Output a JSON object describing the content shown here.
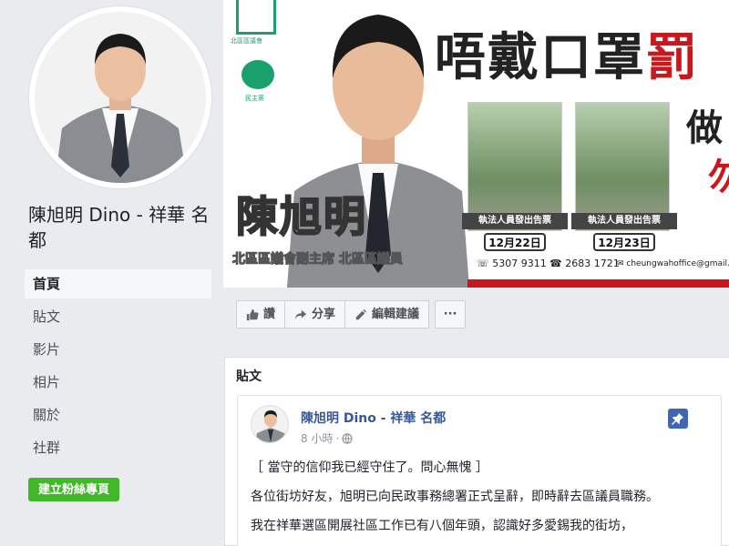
{
  "page": {
    "name": "陳旭明 Dino - 祥華 名都",
    "create_fan_page": "建立粉絲專頁"
  },
  "nav": {
    "items": [
      "首頁",
      "貼文",
      "影片",
      "相片",
      "關於",
      "社群"
    ]
  },
  "cover": {
    "headline_black": "唔戴口罩",
    "headline_red": "罰",
    "logo1_text": "北區區議會",
    "logo2_text": "民主黨",
    "big_name": "陳旭明",
    "subtitle": "北區區議會副主席  北區區議員",
    "photo_label": "執法人員發出告票",
    "date1": "12月22日",
    "date2": "12月23日",
    "side_text1": "做",
    "side_text2": "勿",
    "phone1": "5307 9311",
    "phone2": "2683 1721",
    "email": "cheungwahoffice@gmail.com"
  },
  "actions": {
    "like": "讚",
    "share": "分享",
    "edit": "編輯建議",
    "more": "···"
  },
  "posts": {
    "heading": "貼文",
    "author": "陳旭明 Dino - 祥華 名都",
    "time": "8 小時",
    "paragraphs": [
      "［ 當守的信仰我已經守住了。問心無愧 ］",
      "各位街坊好友，旭明已向民政事務總署正式呈辭，即時辭去區議員職務。",
      "我在祥華選區開展社區工作已有八個年頭，認識好多愛錫我的街坊，"
    ]
  },
  "colors": {
    "brand_blue": "#4267b2",
    "link_blue": "#365899",
    "green_button": "#42b72a",
    "cover_red": "#c8181e"
  }
}
